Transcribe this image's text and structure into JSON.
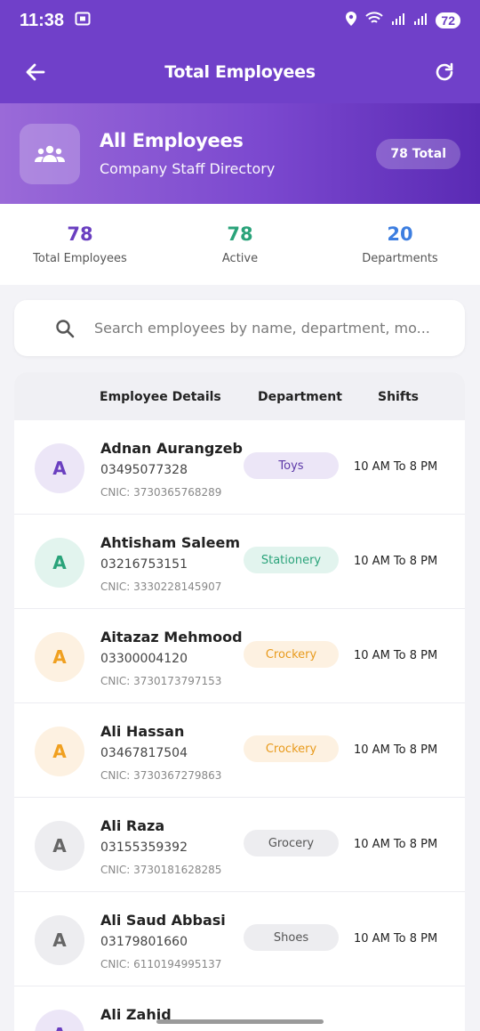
{
  "status_bar": {
    "time": "11:38",
    "battery": "72"
  },
  "app_bar": {
    "title": "Total Employees"
  },
  "hero": {
    "title": "All Employees",
    "subtitle": "Company Staff Directory",
    "badge": "78 Total"
  },
  "stats": [
    {
      "value": "78",
      "label": "Total Employees",
      "color": "#6a3fc0"
    },
    {
      "value": "78",
      "label": "Active",
      "color": "#2aa37a"
    },
    {
      "value": "20",
      "label": "Departments",
      "color": "#3d7ee0"
    }
  ],
  "search": {
    "placeholder": "Search employees by name, department, mo..."
  },
  "table": {
    "headers": {
      "details": "Employee Details",
      "department": "Department",
      "shifts": "Shifts"
    },
    "rows": [
      {
        "initial": "A",
        "name": "Adnan Aurangzeb",
        "phone": "03495077328",
        "cnic": "CNIC: 3730365768289",
        "department": "Toys",
        "shift": "10 AM  To 8 PM",
        "avatar_bg": "#ece6f7",
        "avatar_fg": "#6a3fc0",
        "pill_bg": "#ece6f7",
        "pill_fg": "#5d3aa8"
      },
      {
        "initial": "A",
        "name": "Ahtisham Saleem",
        "phone": "03216753151",
        "cnic": "CNIC: 3330228145907",
        "department": "Stationery",
        "shift": "10 AM  To 8 PM",
        "avatar_bg": "#e2f4ee",
        "avatar_fg": "#2aa37a",
        "pill_bg": "#e2f4ee",
        "pill_fg": "#2aa37a"
      },
      {
        "initial": "A",
        "name": "Aitazaz Mehmood",
        "phone": "03300004120",
        "cnic": "CNIC: 3730173797153",
        "department": "Crockery",
        "shift": "10 AM  To 8 PM",
        "avatar_bg": "#fdf1e1",
        "avatar_fg": "#f0a020",
        "pill_bg": "#fdf1e1",
        "pill_fg": "#e89a1c"
      },
      {
        "initial": "A",
        "name": "Ali Hassan",
        "phone": "03467817504",
        "cnic": "CNIC: 3730367279863",
        "department": "Crockery",
        "shift": "10 AM  To 8 PM",
        "avatar_bg": "#fdf1e1",
        "avatar_fg": "#f0a020",
        "pill_bg": "#fdf1e1",
        "pill_fg": "#e89a1c"
      },
      {
        "initial": "A",
        "name": "Ali Raza",
        "phone": "03155359392",
        "cnic": "CNIC: 3730181628285",
        "department": "Grocery",
        "shift": "10 AM  To 8 PM",
        "avatar_bg": "#ededf0",
        "avatar_fg": "#666666",
        "pill_bg": "#ededf0",
        "pill_fg": "#555555"
      },
      {
        "initial": "A",
        "name": "Ali Saud Abbasi",
        "phone": "03179801660",
        "cnic": "CNIC: 6110194995137",
        "department": "Shoes",
        "shift": "10 AM  To 8 PM",
        "avatar_bg": "#ededf0",
        "avatar_fg": "#666666",
        "pill_bg": "#ededf0",
        "pill_fg": "#555555"
      },
      {
        "initial": "A",
        "name": "Ali Zahid",
        "phone": "",
        "cnic": "",
        "department": "",
        "shift": "",
        "avatar_bg": "#ece6f7",
        "avatar_fg": "#6a3fc0",
        "pill_bg": "#ece6f7",
        "pill_fg": "#5d3aa8"
      }
    ]
  }
}
